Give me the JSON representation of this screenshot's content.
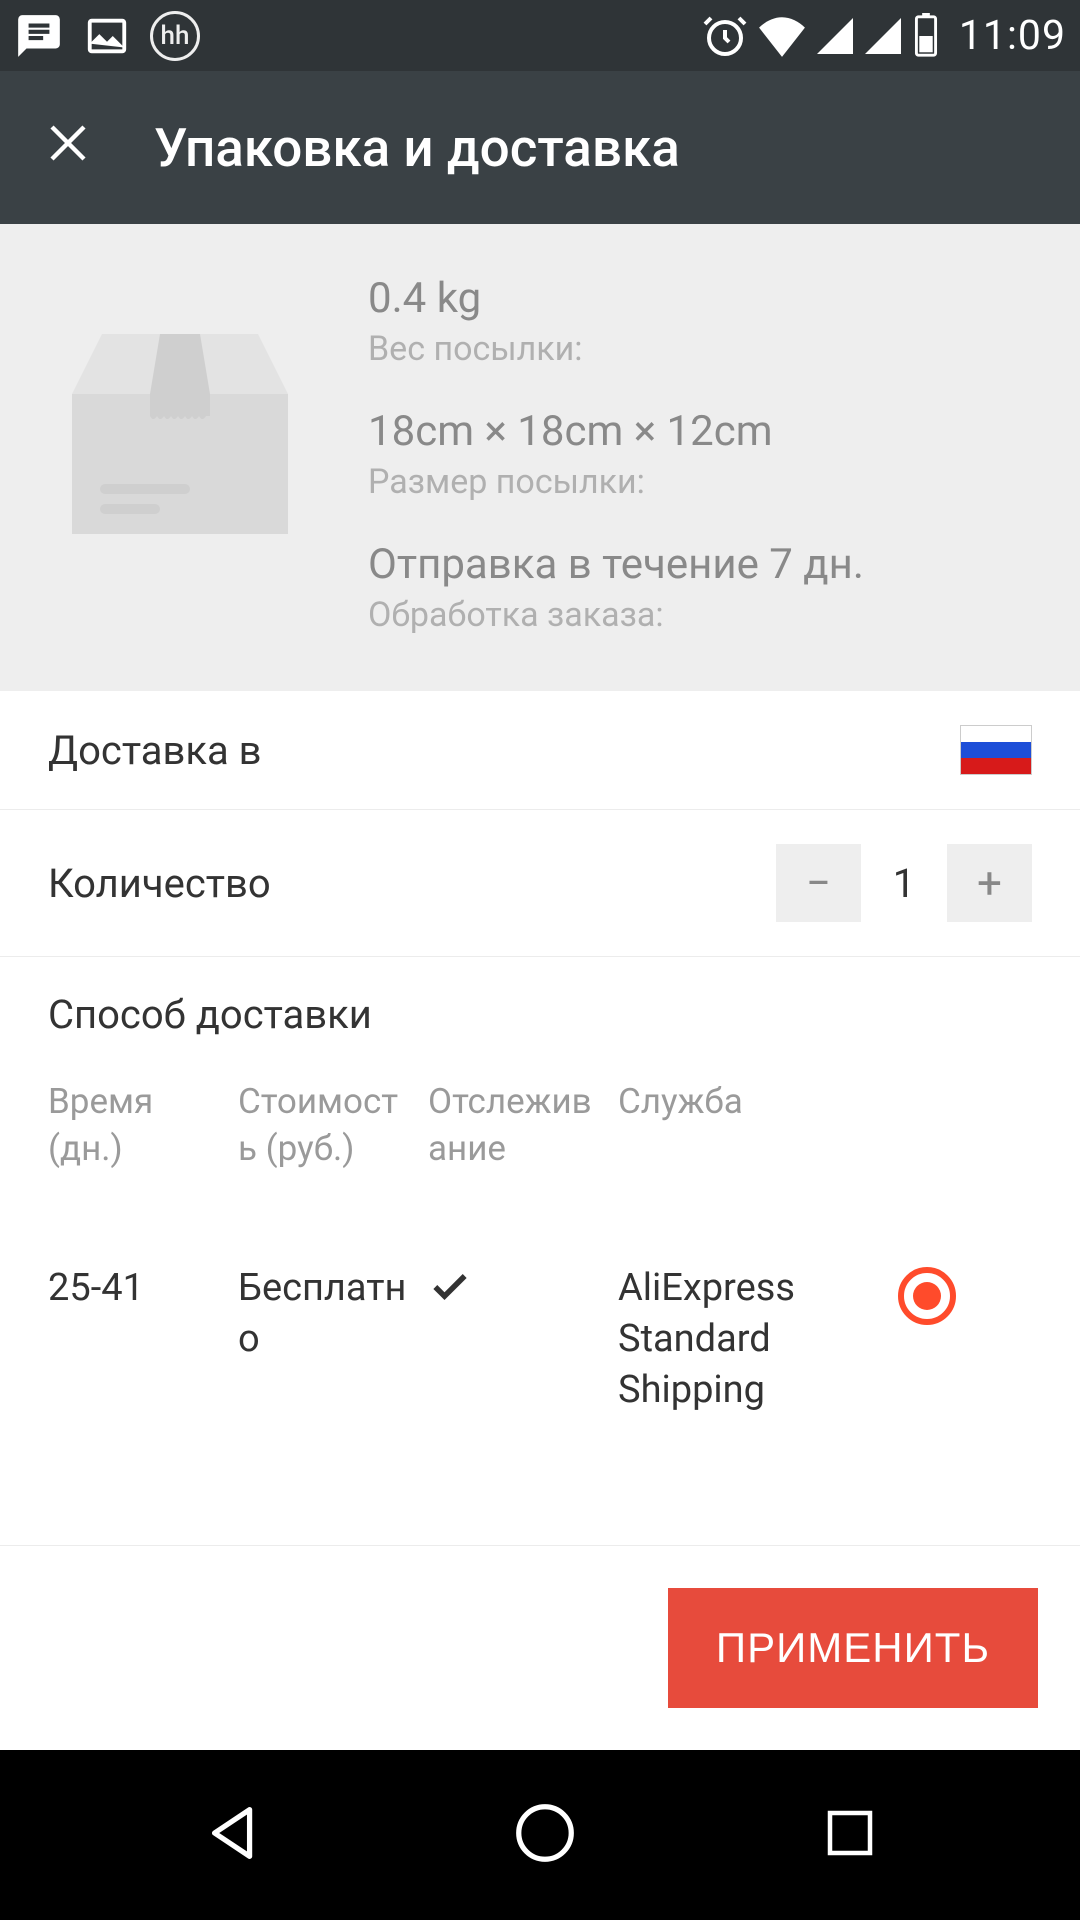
{
  "status": {
    "time": "11:09",
    "hh": "hh"
  },
  "header": {
    "title": "Упаковка и доставка"
  },
  "package": {
    "weight_value": "0.4 kg",
    "weight_label": "Вес посылки:",
    "dims_value": "18cm × 18cm × 12cm",
    "dims_label": "Размер посылки:",
    "ship_value": "Отправка в течение 7 дн.",
    "ship_label": "Обработка заказа:"
  },
  "destination": {
    "label": "Доставка в"
  },
  "quantity": {
    "label": "Количество",
    "value": "1",
    "minus": "−",
    "plus": "+"
  },
  "shipping": {
    "section_title": "Способ доставки",
    "columns": {
      "time": "Время (дн.)",
      "cost": "Стоимость (руб.)",
      "track": "Отслеживание",
      "service": "Служба"
    },
    "options": [
      {
        "time": "25-41",
        "cost": "Бесплатно",
        "track": "✓",
        "service": "AliExpress Standard Shipping",
        "selected": true
      }
    ]
  },
  "footer": {
    "apply": "ПРИМЕНИТЬ"
  }
}
